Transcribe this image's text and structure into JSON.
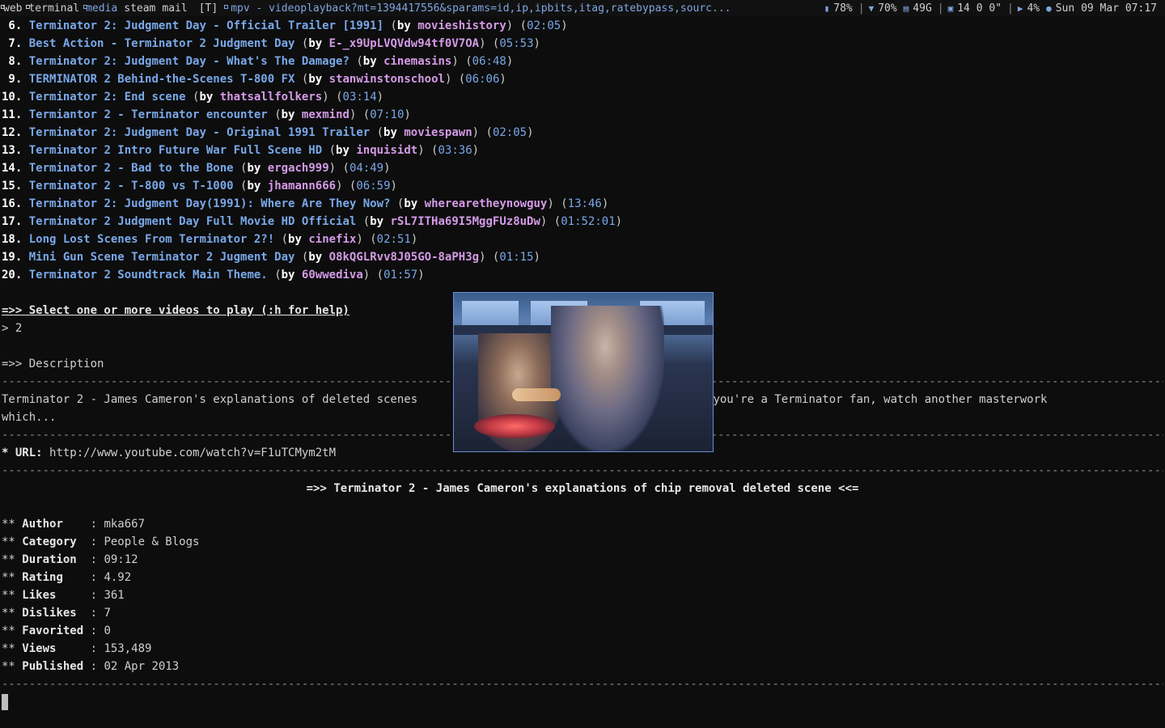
{
  "statusbar": {
    "workspaces": [
      {
        "label": "web",
        "occupied": true,
        "active": false
      },
      {
        "label": "terminal",
        "occupied": true,
        "active": false
      },
      {
        "label": "media",
        "occupied": true,
        "active": true
      },
      {
        "label": "steam",
        "occupied": false,
        "active": false
      },
      {
        "label": "mail",
        "occupied": false,
        "active": false
      }
    ],
    "layout": "[T]",
    "window_title": "mpv - videoplayback?mt=1394417556&sparams=id,ip,ipbits,itag,ratebypass,sourc...",
    "battery": "78%",
    "wifi": "70%",
    "disk": "49G",
    "net": "14 0 0\"",
    "volume": "4%",
    "datetime": "Sun 09 Mar 07:17"
  },
  "results": [
    {
      "num": " 6.",
      "title": "Terminator 2: Judgment Day - Official Trailer [1991]",
      "author": "movieshistory",
      "duration": "02:05"
    },
    {
      "num": " 7.",
      "title": "Best Action - Terminator 2 Judgment Day",
      "author": "E-_x9UpLVQVdw94tf0V7OA",
      "duration": "05:53"
    },
    {
      "num": " 8.",
      "title": "Terminator 2: Judgment Day - What's The Damage?",
      "author": "cinemasins",
      "duration": "06:48"
    },
    {
      "num": " 9.",
      "title": "TERMINATOR 2 Behind-the-Scenes T-800 FX",
      "author": "stanwinstonschool",
      "duration": "06:06"
    },
    {
      "num": "10.",
      "title": "Terminator 2: End scene",
      "author": "thatsallfolkers",
      "duration": "03:14"
    },
    {
      "num": "11.",
      "title": "Termiantor 2 - Terminator encounter",
      "author": "mexmind",
      "duration": "07:10"
    },
    {
      "num": "12.",
      "title": "Terminator 2: Judgment Day - Original 1991 Trailer",
      "author": "moviespawn",
      "duration": "02:05"
    },
    {
      "num": "13.",
      "title": "Terminator 2 Intro Future War Full Scene HD",
      "author": "inquisidt",
      "duration": "03:36"
    },
    {
      "num": "14.",
      "title": "Terminator 2 - Bad to the Bone",
      "author": "ergach999",
      "duration": "04:49"
    },
    {
      "num": "15.",
      "title": "Terminator 2 - T-800 vs T-1000",
      "author": "jhamann666",
      "duration": "06:59"
    },
    {
      "num": "16.",
      "title": "Terminator 2: Judgment Day(1991): Where Are They Now?",
      "author": "wherearetheynowguy",
      "duration": "13:46"
    },
    {
      "num": "17.",
      "title": "Terminator 2 Judgment Day Full Movie HD Official",
      "author": "rSL7ITHa69I5MggFUz8uDw",
      "duration": "01:52:01"
    },
    {
      "num": "18.",
      "title": "Long Lost Scenes From Terminator 2?!",
      "author": "cinefix",
      "duration": "02:51"
    },
    {
      "num": "19.",
      "title": "Mini Gun Scene Terminator 2 Jugment Day",
      "author": "O8kQGLRvv8J05GO-8aPH3g",
      "duration": "01:15"
    },
    {
      "num": "20.",
      "title": "Terminator 2 Soundtrack Main Theme.",
      "author": "60wwediva",
      "duration": "01:57"
    }
  ],
  "by_word": "by",
  "prompt": {
    "question": "=>> Select one or more videos to play (:h for help)",
    "input_line": "> 2"
  },
  "description": {
    "header": "=>> Description",
    "left_text": "Terminator 2 - James Cameron's explanations of deleted scenes",
    "right_text": "If you're a Terminator fan, watch another masterwork",
    "wrap_text": "which...",
    "url_label": "* URL:",
    "url_value": "http://www.youtube.com/watch?v=F1uTCMym2tM"
  },
  "video_title": "=>> Terminator 2 - James Cameron's explanations of chip removal deleted scene <<=",
  "meta": [
    {
      "key": "Author    ",
      "value": "mka667"
    },
    {
      "key": "Category  ",
      "value": "People & Blogs"
    },
    {
      "key": "Duration  ",
      "value": "09:12"
    },
    {
      "key": "Rating    ",
      "value": "4.92"
    },
    {
      "key": "Likes     ",
      "value": "361"
    },
    {
      "key": "Dislikes  ",
      "value": "7"
    },
    {
      "key": "Favorited ",
      "value": "0"
    },
    {
      "key": "Views     ",
      "value": "153,489"
    },
    {
      "key": "Published ",
      "value": "02 Apr 2013"
    }
  ],
  "meta_prefix": "** ",
  "meta_sep": ": "
}
